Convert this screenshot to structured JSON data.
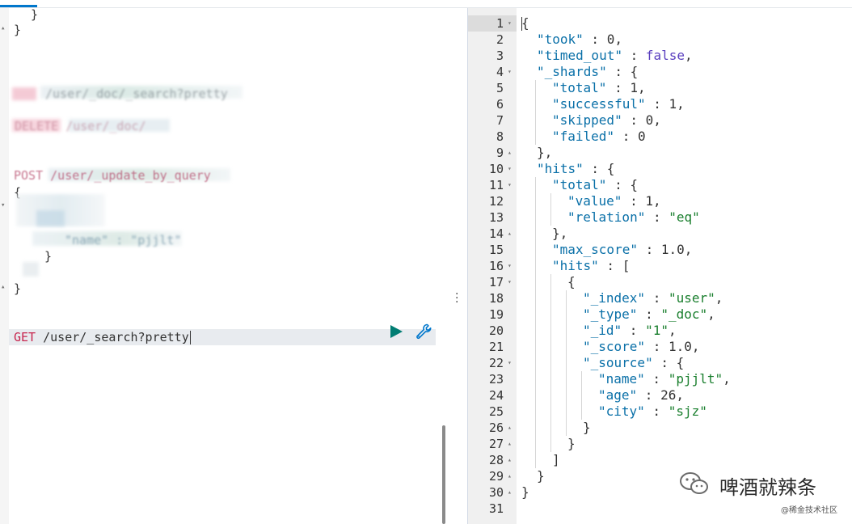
{
  "left_editor": {
    "closing_brace_1": "}",
    "closing_brace_2": "}",
    "blurred_line_1": "/user/_doc/_search?pretty",
    "blurred_line_2": "DELETE /user/_doc/",
    "blurred_line_3": "POST /user/_update_by_query",
    "json_open": "{",
    "blurred_line_4": "\"name\" : \"pjjlt\"",
    "inner_close": "}",
    "json_close": "}",
    "active_request_method": "GET",
    "active_request_path": "/user/_search?pretty"
  },
  "response": {
    "lines": [
      {
        "n": "1",
        "fold": "▾",
        "text": "{"
      },
      {
        "n": "2",
        "fold": "",
        "key": "\"took\"",
        "sep": " : ",
        "val": "0",
        "vtype": "num",
        "tail": ","
      },
      {
        "n": "3",
        "fold": "",
        "key": "\"timed_out\"",
        "sep": " : ",
        "val": "false",
        "vtype": "bool",
        "tail": ","
      },
      {
        "n": "4",
        "fold": "▾",
        "key": "\"_shards\"",
        "sep": " : ",
        "val": "{",
        "vtype": "plain",
        "tail": ""
      },
      {
        "n": "5",
        "fold": "",
        "key": "\"total\"",
        "sep": " : ",
        "val": "1",
        "vtype": "num",
        "tail": ","
      },
      {
        "n": "6",
        "fold": "",
        "key": "\"successful\"",
        "sep": " : ",
        "val": "1",
        "vtype": "num",
        "tail": ","
      },
      {
        "n": "7",
        "fold": "",
        "key": "\"skipped\"",
        "sep": " : ",
        "val": "0",
        "vtype": "num",
        "tail": ","
      },
      {
        "n": "8",
        "fold": "",
        "key": "\"failed\"",
        "sep": " : ",
        "val": "0",
        "vtype": "num",
        "tail": ""
      },
      {
        "n": "9",
        "fold": "▴",
        "text": "},"
      },
      {
        "n": "10",
        "fold": "▾",
        "key": "\"hits\"",
        "sep": " : ",
        "val": "{",
        "vtype": "plain",
        "tail": ""
      },
      {
        "n": "11",
        "fold": "▾",
        "key": "\"total\"",
        "sep": " : ",
        "val": "{",
        "vtype": "plain",
        "tail": ""
      },
      {
        "n": "12",
        "fold": "",
        "key": "\"value\"",
        "sep": " : ",
        "val": "1",
        "vtype": "num",
        "tail": ","
      },
      {
        "n": "13",
        "fold": "",
        "key": "\"relation\"",
        "sep": " : ",
        "val": "\"eq\"",
        "vtype": "str",
        "tail": ""
      },
      {
        "n": "14",
        "fold": "▴",
        "text": "},"
      },
      {
        "n": "15",
        "fold": "",
        "key": "\"max_score\"",
        "sep": " : ",
        "val": "1.0",
        "vtype": "num",
        "tail": ","
      },
      {
        "n": "16",
        "fold": "▾",
        "key": "\"hits\"",
        "sep": " : ",
        "val": "[",
        "vtype": "plain",
        "tail": ""
      },
      {
        "n": "17",
        "fold": "▾",
        "text": "{"
      },
      {
        "n": "18",
        "fold": "",
        "key": "\"_index\"",
        "sep": " : ",
        "val": "\"user\"",
        "vtype": "str",
        "tail": ","
      },
      {
        "n": "19",
        "fold": "",
        "key": "\"_type\"",
        "sep": " : ",
        "val": "\"_doc\"",
        "vtype": "str",
        "tail": ","
      },
      {
        "n": "20",
        "fold": "",
        "key": "\"_id\"",
        "sep": " : ",
        "val": "\"1\"",
        "vtype": "str",
        "tail": ","
      },
      {
        "n": "21",
        "fold": "",
        "key": "\"_score\"",
        "sep": " : ",
        "val": "1.0",
        "vtype": "num",
        "tail": ","
      },
      {
        "n": "22",
        "fold": "▾",
        "key": "\"_source\"",
        "sep": " : ",
        "val": "{",
        "vtype": "plain",
        "tail": ""
      },
      {
        "n": "23",
        "fold": "",
        "key": "\"name\"",
        "sep": " : ",
        "val": "\"pjjlt\"",
        "vtype": "str",
        "tail": ","
      },
      {
        "n": "24",
        "fold": "",
        "key": "\"age\"",
        "sep": " : ",
        "val": "26",
        "vtype": "num",
        "tail": ","
      },
      {
        "n": "25",
        "fold": "",
        "key": "\"city\"",
        "sep": " : ",
        "val": "\"sjz\"",
        "vtype": "str",
        "tail": ""
      },
      {
        "n": "26",
        "fold": "▴",
        "text": "}"
      },
      {
        "n": "27",
        "fold": "▴",
        "text": "}"
      },
      {
        "n": "28",
        "fold": "▴",
        "text": "]"
      },
      {
        "n": "29",
        "fold": "▴",
        "text": "}"
      },
      {
        "n": "30",
        "fold": "▴",
        "text": "}"
      },
      {
        "n": "31",
        "fold": "",
        "text": ""
      }
    ],
    "indents": [
      0,
      1,
      1,
      1,
      2,
      2,
      2,
      2,
      1,
      1,
      2,
      3,
      3,
      2,
      2,
      2,
      3,
      4,
      4,
      4,
      4,
      4,
      5,
      5,
      5,
      4,
      3,
      2,
      1,
      0,
      0
    ]
  },
  "watermark": {
    "title": "啤酒就辣条",
    "subtitle": "@稀金技术社区"
  },
  "colors": {
    "accent": "#0077cc",
    "play": "#017d73",
    "method": "#c7254e",
    "key": "#0a70a8",
    "string": "#1a7f2e"
  }
}
